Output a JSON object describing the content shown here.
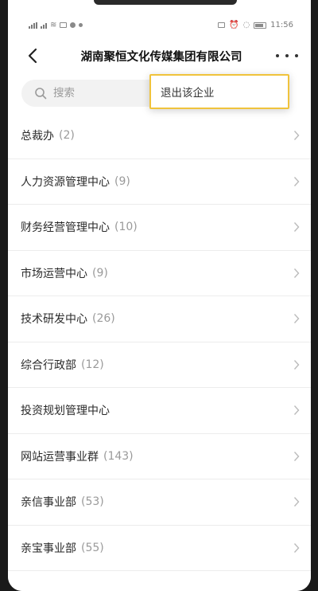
{
  "status": {
    "time": "11:56"
  },
  "header": {
    "title": "湖南聚恒文化传媒集团有限公司"
  },
  "search": {
    "placeholder": "搜索"
  },
  "popup": {
    "item": "退出该企业"
  },
  "departments": [
    {
      "name": "总裁办",
      "count": "(2)"
    },
    {
      "name": "人力资源管理中心",
      "count": "(9)"
    },
    {
      "name": "财务经营管理中心",
      "count": "(10)"
    },
    {
      "name": "市场运营中心",
      "count": "(9)"
    },
    {
      "name": "技术研发中心",
      "count": "(26)"
    },
    {
      "name": "综合行政部",
      "count": "(12)"
    },
    {
      "name": "投资规划管理中心",
      "count": ""
    },
    {
      "name": "网站运营事业群",
      "count": "(143)"
    },
    {
      "name": "亲信事业部",
      "count": "(53)"
    },
    {
      "name": "亲宝事业部",
      "count": "(55)"
    }
  ],
  "colors": {
    "popup_border": "#f0c33c",
    "text": "#2a2a2a",
    "muted": "#9a9a9a"
  }
}
